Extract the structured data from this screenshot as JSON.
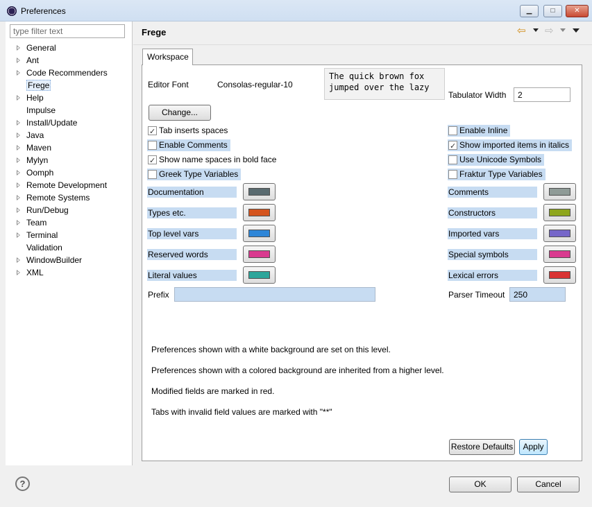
{
  "window": {
    "title": "Preferences"
  },
  "filter": {
    "placeholder": "type filter text"
  },
  "tree": [
    {
      "label": "General",
      "expandable": true
    },
    {
      "label": "Ant",
      "expandable": true
    },
    {
      "label": "Code Recommenders",
      "expandable": true
    },
    {
      "label": "Frege",
      "expandable": false,
      "selected": true
    },
    {
      "label": "Help",
      "expandable": true
    },
    {
      "label": "Impulse",
      "expandable": false
    },
    {
      "label": "Install/Update",
      "expandable": true
    },
    {
      "label": "Java",
      "expandable": true
    },
    {
      "label": "Maven",
      "expandable": true
    },
    {
      "label": "Mylyn",
      "expandable": true
    },
    {
      "label": "Oomph",
      "expandable": true
    },
    {
      "label": "Remote Development",
      "expandable": true
    },
    {
      "label": "Remote Systems",
      "expandable": true
    },
    {
      "label": "Run/Debug",
      "expandable": true
    },
    {
      "label": "Team",
      "expandable": true
    },
    {
      "label": "Terminal",
      "expandable": true
    },
    {
      "label": "Validation",
      "expandable": false
    },
    {
      "label": "WindowBuilder",
      "expandable": true
    },
    {
      "label": "XML",
      "expandable": true
    }
  ],
  "page": {
    "title": "Frege",
    "tab": "Workspace",
    "editor_font_label": "Editor Font",
    "editor_font_value": "Consolas-regular-10",
    "preview_text": "The quick brown fox\njumped over the lazy",
    "tab_width_label": "Tabulator Width",
    "tab_width_value": "2",
    "change_button": "Change...",
    "checkboxes_left": [
      {
        "label": "Tab inserts spaces",
        "checked": true,
        "inherited": false
      },
      {
        "label": "Enable Comments",
        "checked": false,
        "inherited": true
      },
      {
        "label": "Show name spaces in bold face",
        "checked": true,
        "inherited": false
      },
      {
        "label": "Greek Type Variables",
        "checked": false,
        "inherited": true
      }
    ],
    "checkboxes_right": [
      {
        "label": "Enable Inline",
        "checked": false,
        "inherited": true
      },
      {
        "label": "Show imported items in italics",
        "checked": true,
        "inherited": true
      },
      {
        "label": "Use Unicode Symbols",
        "checked": false,
        "inherited": true
      },
      {
        "label": "Fraktur Type Variables",
        "checked": false,
        "inherited": true
      }
    ],
    "colors_left": [
      {
        "label": "Documentation",
        "color": "#5a6b70"
      },
      {
        "label": "Types etc.",
        "color": "#d4541e"
      },
      {
        "label": "Top level vars",
        "color": "#2e86d8"
      },
      {
        "label": "Reserved words",
        "color": "#d93a8f"
      },
      {
        "label": "Literal values",
        "color": "#2ea69b"
      }
    ],
    "colors_right": [
      {
        "label": "Comments",
        "color": "#8f9b97"
      },
      {
        "label": "Constructors",
        "color": "#8ea61c"
      },
      {
        "label": "Imported vars",
        "color": "#7566c9"
      },
      {
        "label": "Special symbols",
        "color": "#d93a8f"
      },
      {
        "label": "Lexical errors",
        "color": "#d93434"
      }
    ],
    "prefix_label": "Prefix",
    "prefix_value": "",
    "parser_timeout_label": "Parser Timeout",
    "parser_timeout_value": "250",
    "info": [
      "Preferences shown with a white background are set on this level.",
      "Preferences shown with a colored background are inherited from a higher level.",
      "Modified fields are marked in red.",
      "Tabs with invalid field values are marked with \"**\""
    ],
    "restore_defaults": "Restore Defaults",
    "apply": "Apply"
  },
  "footer": {
    "ok": "OK",
    "cancel": "Cancel",
    "help_icon": "question-icon"
  },
  "colors": {
    "inherited_bg": "#c7dcf2",
    "title_bar": "#d4e3f4",
    "close_button": "#c84a33"
  }
}
